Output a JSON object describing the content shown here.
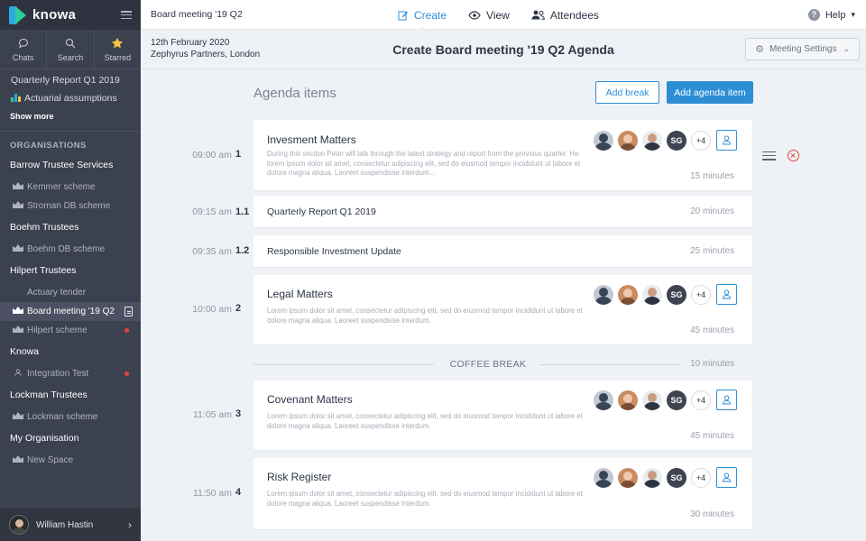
{
  "sidebar": {
    "brand": "knowa",
    "tools": [
      {
        "label": "Chats",
        "icon": "chat-icon"
      },
      {
        "label": "Search",
        "icon": "search-icon"
      },
      {
        "label": "Starred",
        "icon": "star-icon"
      }
    ],
    "recent": [
      {
        "label": "Quarterly Report Q1 2019"
      },
      {
        "label": "Actuarial assumptions",
        "icon": "chart-icon"
      }
    ],
    "show_more": "Show more",
    "organisations_heading": "ORGANISATIONS",
    "orgs": [
      {
        "name": "Barrow Trustee Services",
        "items": [
          {
            "label": "Kemmer scheme"
          },
          {
            "label": "Stroman DB scheme"
          }
        ]
      },
      {
        "name": "Boehm Trustees",
        "items": [
          {
            "label": "Boehm DB scheme"
          }
        ]
      },
      {
        "name": "Hilpert Trustees",
        "items": [
          {
            "label": "Actuary tender"
          },
          {
            "label": "Board meeting '19 Q2"
          },
          {
            "label": "Hilpert scheme"
          }
        ]
      },
      {
        "name": "Knowa",
        "items": [
          {
            "label": "Integration Test"
          }
        ]
      },
      {
        "name": "Lockman Trustees",
        "items": [
          {
            "label": "Lockman scheme"
          }
        ]
      },
      {
        "name": "My Organisation",
        "items": [
          {
            "label": "New Space"
          }
        ]
      }
    ],
    "user_name": "William Hastin",
    "colors": {
      "background": "#3c4150",
      "brand_blue": "#2ea6e0",
      "brand_green": "#2ecc9a",
      "notification": "#e0453c"
    }
  },
  "topbar": {
    "doc_title": "Board meeting '19 Q2",
    "tabs": [
      {
        "label": "Create",
        "icon": "edit-icon",
        "active": true
      },
      {
        "label": "View",
        "icon": "eye-icon",
        "active": false
      },
      {
        "label": "Attendees",
        "icon": "users-icon",
        "active": false
      }
    ],
    "help": "Help"
  },
  "subheader": {
    "date": "12th February 2020",
    "location": "Zephyrus Partners, London",
    "title": "Create Board meeting '19 Q2 Agenda",
    "settings_label": "Meeting Settings"
  },
  "agenda": {
    "heading": "Agenda items",
    "add_break": "Add break",
    "add_item": "Add agenda item",
    "accent_color": "#2d8ed6",
    "items": [
      {
        "time": "09:00 am",
        "num": "1",
        "title": "Invesment Matters",
        "desc": "During this seciton Peter will talk through the latest strategy and report from the previous quarter. He lorem ipsum dolor sit amet, consectetur adipiscing elit, sed do eiusmod tempor incididunt ut labore et dolore magna aliqua. Laoreet suspendisse interdum...",
        "duration": "15 minutes",
        "initials": "SG",
        "more": "+4"
      },
      {
        "time": "09:15 am",
        "num": "1.1",
        "title": "Quarterly Report Q1 2019",
        "duration": "20 minutes"
      },
      {
        "time": "09:35 am",
        "num": "1.2",
        "title": "Responsible Investment Update",
        "duration": "25 minutes"
      },
      {
        "time": "10:00 am",
        "num": "2",
        "title": "Legal Matters",
        "desc": "Lorem ipsum dolor sit amet, consectetur adipiscing elit, sed do eiusmod tempor incididunt ut labore et dolore magna aliqua. Laoreet suspendisse interdum.",
        "duration": "45 minutes",
        "initials": "SG",
        "more": "+4"
      },
      {
        "time": "11:05 am",
        "num": "3",
        "title": "Covenant Matters",
        "desc": "Lorem ipsum dolor sit amet, consectetur adipiscing elit, sed do eiusmod tempor incididunt ut labore et dolore magna aliqua. Laoreet suspendisse interdum.",
        "duration": "45 minutes",
        "initials": "SG",
        "more": "+4"
      },
      {
        "time": "11:50 am",
        "num": "4",
        "title": "Risk Register",
        "desc": "Lorem ipsum dolor sit amet, consectetur adipiscing elit, sed do eiusmod tempor incididunt ut labore et dolore magna aliqua. Laoreet suspendisse interdum.",
        "duration": "30 minutes",
        "initials": "SG",
        "more": "+4"
      }
    ],
    "break": {
      "label": "COFFEE BREAK",
      "duration": "10 minutes"
    }
  }
}
